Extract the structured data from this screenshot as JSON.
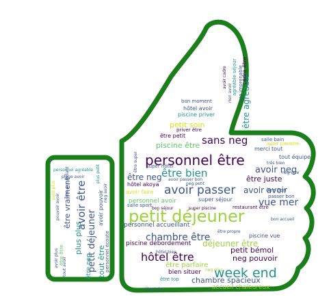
{
  "colors": {
    "outline": "#1a7f1a",
    "background": "#ffffff",
    "word_palette": [
      "#440154",
      "#3b528b",
      "#21918c",
      "#5ec962",
      "#9cd13d",
      "#d8e219",
      "#2a788e",
      "#31688e"
    ]
  },
  "words": {
    "petit_dejeuner": "petit déjeuner",
    "personnel_etre": "personnel être",
    "avoir_passer": "avoir passer",
    "week_end": "week end",
    "sans_neg": "sans neg",
    "etre_bien": "être bien",
    "avoir_neg": "avoir neg",
    "hotel_etre": "hôtel être",
    "chambre_etre": "chambre être",
    "vue_mer": "vue mer",
    "etre_neg": "être neg",
    "avoir_etre": "avoir être",
    "petit_dejeuner_small": "petit déjeuner",
    "avoir_avoir": "avoir avoir",
    "dejeuner_etre": "déjeuner être",
    "etre_agreable": "être agréable",
    "etre_juste": "être juste",
    "piscine_etre": "piscine être",
    "petit_soin": "petit soin",
    "chambre_spacieux": "chambre spacieux",
    "neg_pouvoir": "neg pouvoir",
    "petit_bemol": "petit bémol",
    "etre_parfaire": "être parfaire",
    "personnel_accueillant": "personnel accueillant",
    "piscine_debordement": "piscine débordement",
    "etre_vraiment": "être vraiment",
    "plus_plus": "plus plus",
    "tout_etre": "tout être",
    "personnel_avoir": "personnel avoir",
    "hotel_akoya": "hôtel akoya",
    "etre_neg_small": "être neg",
    "bien_situer": "bien situer",
    "accueil_chaleureux": "accueil chaleureux",
    "cadre_etre": "cadre être",
    "piscine_priver": "piscine priver",
    "hotel_avoir": "hôtel avoir",
    "bon_moment": "bon moment",
    "merci_tout": "merci tout",
    "etre_bon": "être bon",
    "super_sejour": "super séjour",
    "piscine_vue": "piscine vue",
    "etre_petit": "être petit",
    "avoir_pouvoir": "avoir pouvoir",
    "personnel_ecoute": "personnel écoute",
    "agreable_sejour": "agréable séjour",
    "vue_imprenable": "vue imprenable",
    "tout_equipe": "tout équipe",
    "restaurant_etre": "restaurant être",
    "etre_top": "être top",
    "avoir_prendre": "avoir prendre",
    "salle_bain": "salle bain",
    "passer_bon": "passer bon",
    "super_hotel": "super hôtel",
    "priver_etre": "priver être",
    "avoir_faire": "avoir faire",
    "etre_etre": "être être",
    "salle_sport": "salle sport",
    "pouvoir_avoir": "pouvoir avoir",
    "avoir_passer_bon": "avoir passer bon",
    "neg_plus": "neg plus",
    "etre_tres": "être très",
    "rien_avoir": "rien avoir",
    "tout_avoir": "tout avoir",
    "avoir_plus": "avoir plus",
    "neg_avoir": "neg avoir",
    "bon_sejour": "bon séjour",
    "petit_plus": "petit plus",
    "super_piscine": "super piscine",
    "plus_petit": "plus petit",
    "plage_avoir": "plage avoir",
    "hotel_bien": "hôtel bien",
    "etre_propre": "être propre",
    "etre_super": "être super",
    "neg_etre": "neg être",
    "bon_accueil": "bon accueil",
    "personnel_agreable": "personnel agréable",
    "etre_accueillant": "être accueillant",
    "neg_petit": "neg petit",
    "avoir_cadre": "avoir cadre",
    "tres_bien": "très bien"
  }
}
